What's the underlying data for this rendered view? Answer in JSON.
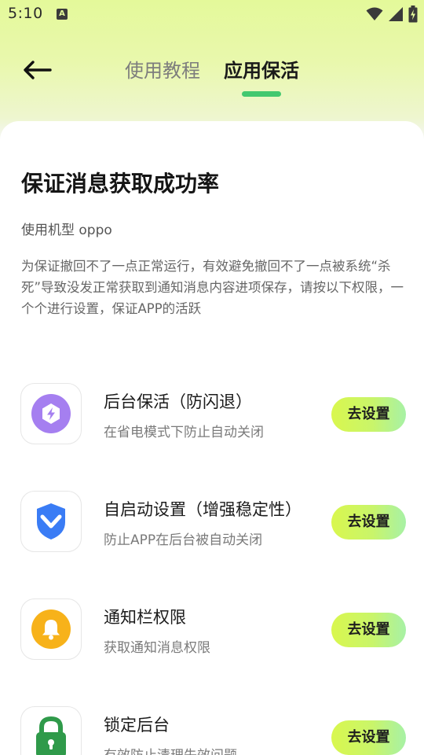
{
  "status_bar": {
    "time": "5:10",
    "notification_glyph": "A",
    "icons": [
      "wifi-icon",
      "cell-signal-icon",
      "battery-charging-icon"
    ]
  },
  "header": {
    "back_icon": "arrow-left-icon",
    "tabs": [
      {
        "label": "使用教程",
        "active": false
      },
      {
        "label": "应用保活",
        "active": true
      }
    ]
  },
  "content": {
    "title": "保证消息获取成功率",
    "model_line": "使用机型 oppo",
    "description": "为保证撤回不了一点正常运行，有效避免撤回不了一点被系统“杀死”导致没发正常获取到通知消息内容进项保存，请按以下权限，一个个进行设置，保证APP的活跃",
    "items": [
      {
        "icon": "lightning-shield-icon",
        "title": "后台保活（防闪退）",
        "desc": "在省电模式下防止自动关闭",
        "button": "去设置"
      },
      {
        "icon": "shield-check-icon",
        "title": "自启动设置（增强稳定性）",
        "desc": "防止APP在后台被自动关闭",
        "button": "去设置"
      },
      {
        "icon": "bell-icon",
        "title": "通知栏权限",
        "desc": "获取通知消息权限",
        "button": "去设置"
      },
      {
        "icon": "lock-icon",
        "title": "锁定后台",
        "desc": "有效防止清理失效问题",
        "button": "去设置"
      }
    ]
  },
  "colors": {
    "accent_green": "#43c86f",
    "button_gradient_start": "#d9f74e",
    "button_gradient_end": "#a7f1a6",
    "header_bg": "#e4f99a",
    "icon_purple": "#a57ff0",
    "icon_blue": "#3a7cf5",
    "icon_yellow": "#f7b21a",
    "icon_green": "#2f9a4a"
  }
}
